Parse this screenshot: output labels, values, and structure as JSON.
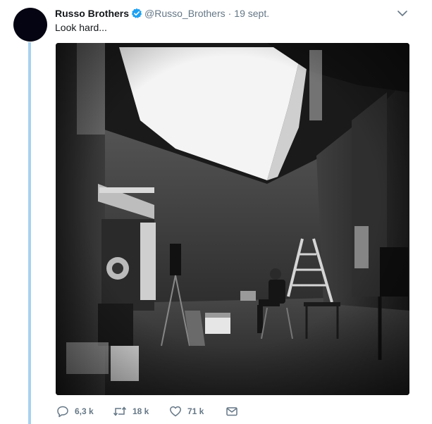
{
  "tweet": {
    "author_name": "Russo Brothers",
    "handle": "@Russo_Brothers",
    "separator": "·",
    "date": "19 sept.",
    "text": "Look hard...",
    "verified": true,
    "image_alt": "Black and white photo of a film set with a man sitting in a folding chair next to a ladder"
  },
  "actions": {
    "replies": "6,3 k",
    "retweets": "18 k",
    "likes": "71 k"
  },
  "colors": {
    "thread_line": "#a8d1ef",
    "verified_blue": "#1da1f2",
    "muted_text": "#657786"
  },
  "icons": [
    "verified-badge-icon",
    "caret-down-icon",
    "reply-icon",
    "retweet-icon",
    "like-icon",
    "direct-message-icon"
  ]
}
